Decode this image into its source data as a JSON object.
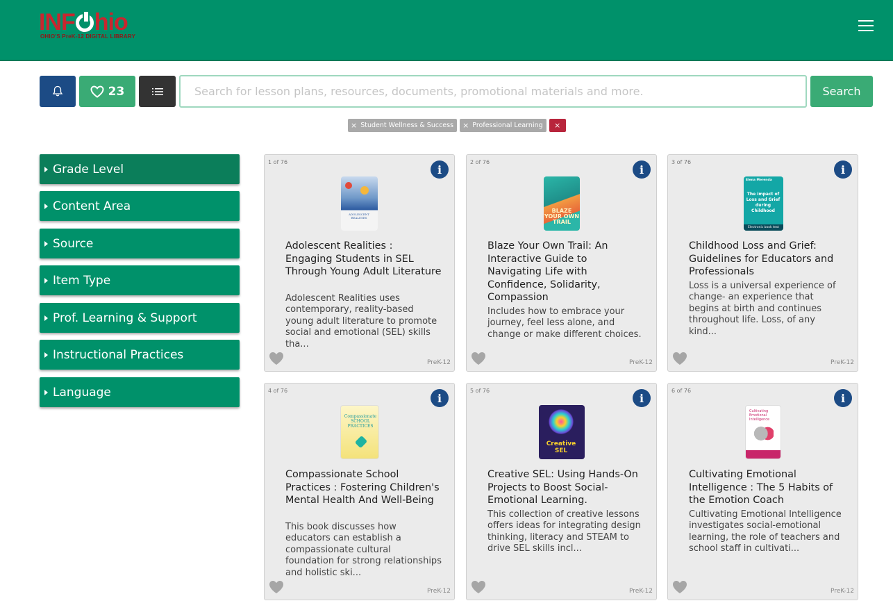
{
  "header": {
    "logo_main": "INFOhio",
    "logo_prefix": "INF",
    "logo_suffix": "hio",
    "logo_sub": "OHIO'S PreK-12 DIGITAL LIBRARY",
    "background_color": "#00916a"
  },
  "toolbar": {
    "favorites_count": "23",
    "search_placeholder": "Search for lesson plans, resources, documents, promotional materials and more.",
    "search_value": "",
    "search_label": "Search"
  },
  "filters": {
    "chips": [
      "Student Wellness & Success",
      "Professional Learning"
    ],
    "clear_label": "×"
  },
  "sidebar": {
    "items": [
      {
        "label": "Grade Level"
      },
      {
        "label": "Content Area"
      },
      {
        "label": "Source"
      },
      {
        "label": "Item Type"
      },
      {
        "label": "Prof. Learning & Support"
      },
      {
        "label": "Instructional Practices"
      },
      {
        "label": "Language"
      }
    ]
  },
  "results": {
    "cards": [
      {
        "count": "1 of 76",
        "title": "Adolescent Realities : Engaging Students in SEL Through Young Adult Literature",
        "description": "Adolescent Realities uses contemporary, reality-based young adult literature to promote social and emotional (SEL) skills tha...",
        "grade": "PreK-12",
        "cover_text": "ADOLESCENT REALITIES"
      },
      {
        "count": "2 of 76",
        "title": "Blaze Your Own Trail: An Interactive Guide to Navigating Life with Confidence, Solidarity, Compassion",
        "description": "Includes how to embrace your journey, feel less alone, and change or make different choices.",
        "grade": "PreK-12",
        "cover_text": "BLAZE YOUR OWN TRAIL"
      },
      {
        "count": "3 of 76",
        "title": "Childhood Loss and Grief: Guidelines for Educators and Professionals",
        "description": "Loss is a universal experience of change- an experience that begins at birth and continues throughout life. Loss, of any kind...",
        "grade": "PreK-12",
        "cover_author": "Elena Merenda",
        "cover_text": "The impact of Loss and Grief during Childhood",
        "cover_badge": "Electronic book text"
      },
      {
        "count": "4 of 76",
        "title": "Compassionate School Practices : Fostering Children's Mental Health And Well-Being",
        "description": "This book discusses how educators can establish a compassionate cultural foundation for strong relationships and holistic ski...",
        "grade": "PreK-12",
        "cover_text": "Compassionate SCHOOL PRACTICES"
      },
      {
        "count": "5 of 76",
        "title": "Creative SEL: Using Hands-On Projects to Boost Social-Emotional Learning.",
        "description": "This collection of creative lessons offers ideas for integrating design thinking, literacy and STEAM to drive SEL skills incl...",
        "grade": "PreK-12",
        "cover_text": "Creative SEL"
      },
      {
        "count": "6 of 76",
        "title": "Cultivating Emotional Intelligence : The 5 Habits of the Emotion Coach",
        "description": "Cultivating Emotional Intelligence investigates social-emotional learning, the role of teachers and school staff in cultivati...",
        "grade": "PreK-12",
        "cover_text": "Cultivating Emotional Intelligence"
      }
    ]
  },
  "colors": {
    "primary_green": "#00916a",
    "accent_green": "#3aab75",
    "navy": "#1c4b85",
    "dark": "#333333",
    "clear_red": "#b8253c"
  }
}
